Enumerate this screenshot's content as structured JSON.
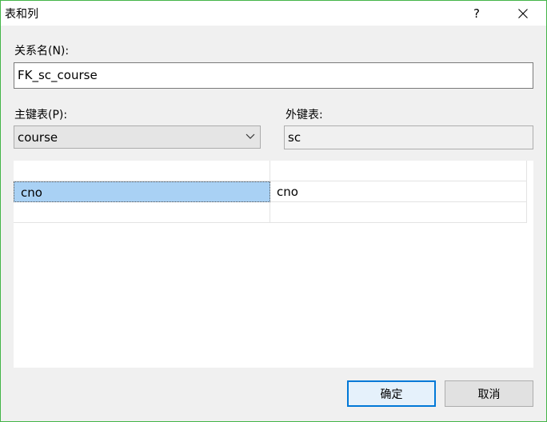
{
  "window": {
    "title": "表和列",
    "help_label": "?"
  },
  "form": {
    "relation_name_label": "关系名(N):",
    "relation_name_value": "FK_sc_course",
    "primary_table_label": "主键表(P):",
    "primary_table_value": "course",
    "foreign_table_label": "外键表:",
    "foreign_table_value": "sc"
  },
  "grid": {
    "rows": [
      {
        "primary": "",
        "foreign": ""
      },
      {
        "primary": "cno",
        "foreign": "cno"
      },
      {
        "primary": "",
        "foreign": ""
      }
    ]
  },
  "buttons": {
    "ok_label": "确定",
    "cancel_label": "取消"
  },
  "icons": {
    "close": "close-icon",
    "dropdown": "chevron-down-icon"
  }
}
